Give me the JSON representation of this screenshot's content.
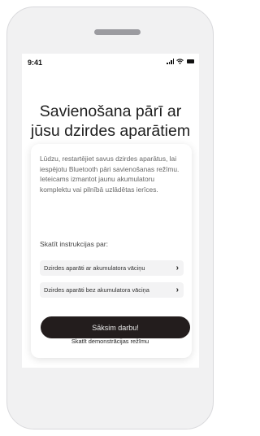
{
  "status_bar": {
    "time": "9:41"
  },
  "title_line1": "Savienošana pārī ar",
  "title_line2": "jūsu dzirdes aparātiem",
  "body": {
    "para1": "Lūdzu, restartējiet savus dzirdes aparātus, lai iespējotu Bluetooth pāri savienošanas režīmu.",
    "para2": "Ieteicams izmantot jaunu akumulatoru komplektu vai pilnībā uzlādētas ierīces."
  },
  "instructions_heading": "Skatīt instrukcijas par:",
  "options": [
    {
      "label": "Dzirdes aparāti ar akumulatora vāciņu",
      "chevron": "›"
    },
    {
      "label": "Dzirdes aparāti bez akumulatora vāciņa",
      "chevron": "›"
    }
  ],
  "start_button": "Sāksim darbu!",
  "demo_link": "Skatīt demonstrācijas režīmu",
  "icons": [
    "signal-icon",
    "wifi-icon",
    "battery-icon",
    "chevron-right-icon"
  ],
  "colors": {
    "button": "#231d1d",
    "option_bg": "#f3f3f4",
    "device_frame": "#f1f1f2"
  }
}
